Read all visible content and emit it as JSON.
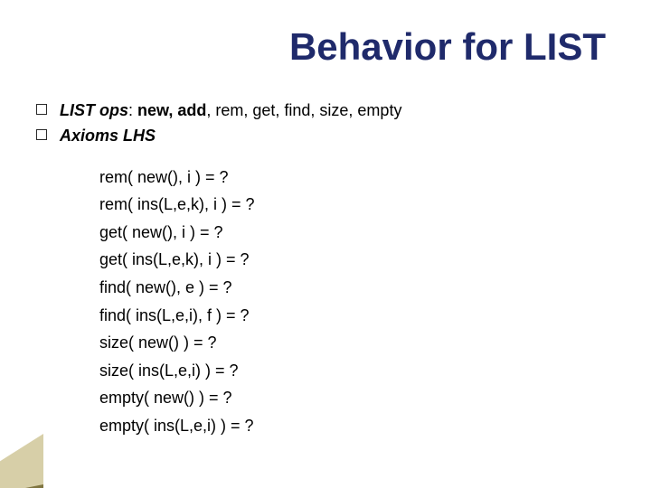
{
  "title": "Behavior for LIST",
  "bullets": {
    "ops_prefix": "LIST ops",
    "ops_colon": ": ",
    "ops_bold": "new, add",
    "ops_rest": ", rem, get, find, size, empty",
    "axioms": "Axioms LHS"
  },
  "axioms_lines": [
    "rem( new(), i ) = ?",
    "rem( ins(L,e,k), i ) = ?",
    "get( new(), i ) = ?",
    "get( ins(L,e,k), i ) = ?",
    "find( new(), e ) = ?",
    "find( ins(L,e,i), f ) = ?",
    "size( new() ) = ?",
    "size( ins(L,e,i) ) = ?",
    "empty( new() ) = ?",
    "empty( ins(L,e,i) ) = ?"
  ]
}
